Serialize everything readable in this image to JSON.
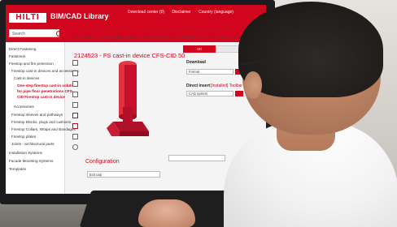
{
  "app": {
    "brand": "HILTI",
    "library_title": "BIM/CAD Library",
    "topnav": [
      "Download center (0)",
      "Disclaimer",
      "Country (language)"
    ]
  },
  "search": {
    "label": "Search"
  },
  "sidebar": {
    "items": [
      {
        "label": "Direct Fastening",
        "active": false
      },
      {
        "label": "Fasteners",
        "active": false
      },
      {
        "label": "Firestop and fire protection",
        "active": false
      },
      {
        "label": "Firestop cast-in devices and accessories",
        "active": false
      },
      {
        "label": "Cast-in devices",
        "active": false
      },
      {
        "label": "One-step firestop cast-in solution",
        "active": true
      },
      {
        "label": "for pipe floor penetrations CFS-",
        "active": true
      },
      {
        "label": "CID Firestop cast-in device",
        "active": true
      },
      {
        "label": "Accessories",
        "active": false
      },
      {
        "label": "Firestop sleeves and pathways",
        "active": false
      },
      {
        "label": "Firestop Blocks, plugs and cushions",
        "active": false
      },
      {
        "label": "Firestop Collars, Wraps and Bandages",
        "active": false
      },
      {
        "label": "Firestop plates",
        "active": false
      },
      {
        "label": "Joints - architectural parts",
        "active": false
      },
      {
        "label": "Installation Systems",
        "active": false
      },
      {
        "label": "Facade Mounting Systems",
        "active": false
      },
      {
        "label": "Templates",
        "active": false
      }
    ]
  },
  "main": {
    "breadcrumb": "Cast-in devices > One-step firestop cast-in solution for pipe floor penetrations CFS-CID Firestop cast-in device",
    "title": "2124523 - FS cast-in device CFS-CID 50",
    "configuration_label": "Configuration",
    "config_value": "Ecit cap"
  },
  "panel": {
    "tab_active_label": "3D",
    "download_label": "Download",
    "format_value": "Format",
    "direct_insert_label": "Direct insert",
    "direct_insert_link": "[Installed] Toolbar",
    "cad_value": "CAD system"
  },
  "colors": {
    "brand_red": "#d2051e"
  }
}
